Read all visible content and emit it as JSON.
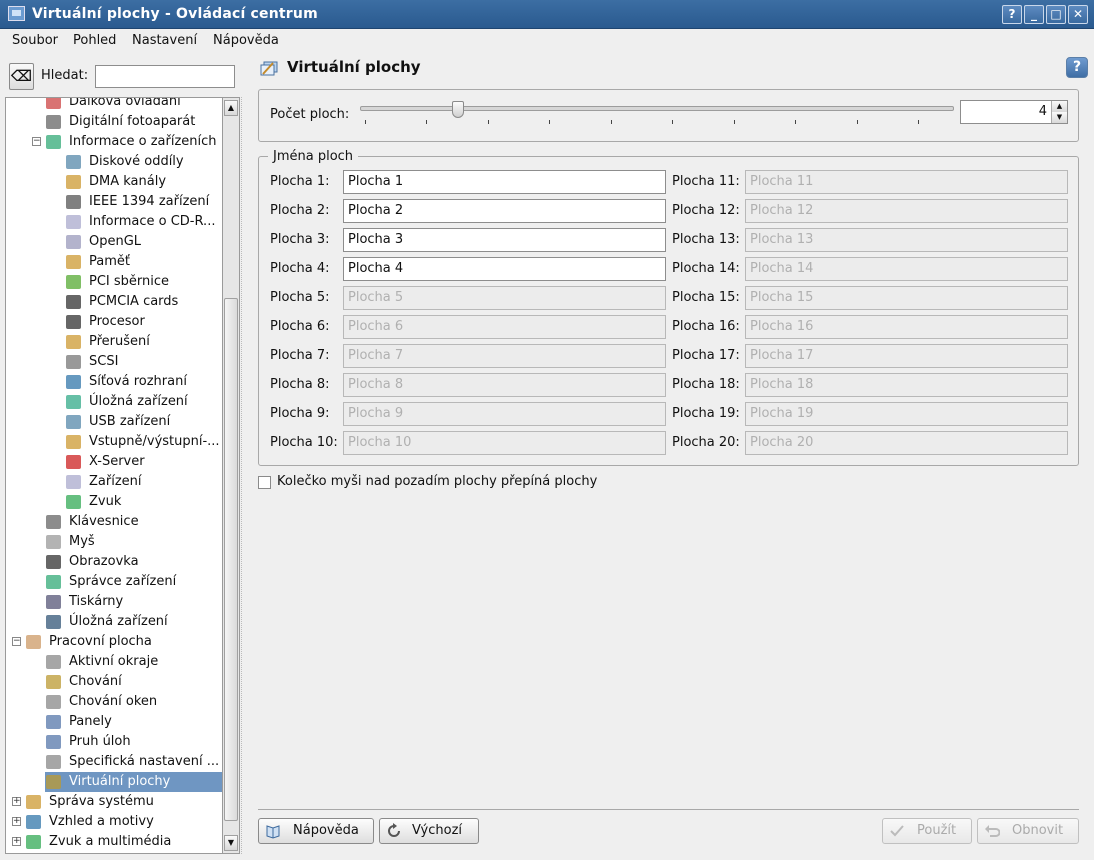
{
  "window": {
    "title": "Virtuální plochy - Ovládací centrum"
  },
  "titlebar_buttons": [
    "?",
    "_",
    "□",
    "✕"
  ],
  "menu": [
    "Soubor",
    "Pohled",
    "Nastavení",
    "Nápověda"
  ],
  "search": {
    "label": "Hledat:",
    "value": ""
  },
  "tree": [
    {
      "label": "Dálková ovládání",
      "icon": "remote-icon",
      "level": 2
    },
    {
      "label": "Digitální fotoaparát",
      "icon": "camera-icon",
      "level": 2
    },
    {
      "label": "Informace o zařízeních",
      "icon": "info-device-icon",
      "level": 2,
      "expander": "−"
    },
    {
      "label": "Diskové oddíly",
      "icon": "disk-partitions-icon",
      "level": 3
    },
    {
      "label": "DMA kanály",
      "icon": "dma-icon",
      "level": 3
    },
    {
      "label": "IEEE 1394 zařízení",
      "icon": "firewire-icon",
      "level": 3
    },
    {
      "label": "Informace o CD-R...",
      "icon": "cdrom-icon",
      "level": 3
    },
    {
      "label": "OpenGL",
      "icon": "opengl-icon",
      "level": 3
    },
    {
      "label": "Paměť",
      "icon": "memory-icon",
      "level": 3
    },
    {
      "label": "PCI sběrnice",
      "icon": "pci-icon",
      "level": 3
    },
    {
      "label": "PCMCIA cards",
      "icon": "pcmcia-icon",
      "level": 3
    },
    {
      "label": "Procesor",
      "icon": "cpu-icon",
      "level": 3
    },
    {
      "label": "Přerušení",
      "icon": "interrupt-icon",
      "level": 3
    },
    {
      "label": "SCSI",
      "icon": "scsi-icon",
      "level": 3
    },
    {
      "label": "Síťová rozhraní",
      "icon": "network-icon",
      "level": 3
    },
    {
      "label": "Úložná zařízení",
      "icon": "storage-icon",
      "level": 3
    },
    {
      "label": "USB zařízení",
      "icon": "usb-icon",
      "level": 3
    },
    {
      "label": "Vstupně/výstupní-...",
      "icon": "io-port-icon",
      "level": 3
    },
    {
      "label": "X-Server",
      "icon": "x-server-icon",
      "level": 3
    },
    {
      "label": "Zařízení",
      "icon": "devices-icon",
      "level": 3
    },
    {
      "label": "Zvuk",
      "icon": "sound-icon",
      "level": 3
    },
    {
      "label": "Klávesnice",
      "icon": "keyboard-icon",
      "level": 2
    },
    {
      "label": "Myš",
      "icon": "mouse-icon",
      "level": 2
    },
    {
      "label": "Obrazovka",
      "icon": "display-icon",
      "level": 2
    },
    {
      "label": "Správce zařízení",
      "icon": "device-manager-icon",
      "level": 2
    },
    {
      "label": "Tiskárny",
      "icon": "printer-icon",
      "level": 2
    },
    {
      "label": "Úložná zařízení",
      "icon": "storage-media-icon",
      "level": 2
    },
    {
      "label": "Pracovní plocha",
      "icon": "desktop-icon",
      "level": 1,
      "expander": "−"
    },
    {
      "label": "Aktivní okraje",
      "icon": "active-borders-icon",
      "level": 2
    },
    {
      "label": "Chování",
      "icon": "behavior-icon",
      "level": 2
    },
    {
      "label": "Chování oken",
      "icon": "window-behavior-icon",
      "level": 2
    },
    {
      "label": "Panely",
      "icon": "panels-icon",
      "level": 2
    },
    {
      "label": "Pruh úloh",
      "icon": "taskbar-icon",
      "level": 2
    },
    {
      "label": "Specifická nastavení ...",
      "icon": "window-specific-icon",
      "level": 2
    },
    {
      "label": "Virtuální plochy",
      "icon": "virtual-desktops-icon",
      "level": 2,
      "selected": true
    },
    {
      "label": "Správa systému",
      "icon": "system-admin-icon",
      "level": 1,
      "expander": "+"
    },
    {
      "label": "Vzhled a motivy",
      "icon": "appearance-icon",
      "level": 1,
      "expander": "+"
    },
    {
      "label": "Zvuk a multimédia",
      "icon": "multimedia-icon",
      "level": 1,
      "expander": "+"
    }
  ],
  "page": {
    "title": "Virtuální plochy"
  },
  "desktops": {
    "count_label": "Počet ploch:",
    "count": 4,
    "slider": {
      "min": 1,
      "max": 20
    },
    "names_group": "Jména ploch",
    "items": [
      {
        "label": "Plocha 1:",
        "value": "Plocha 1",
        "enabled": true
      },
      {
        "label": "Plocha 2:",
        "value": "Plocha 2",
        "enabled": true
      },
      {
        "label": "Plocha 3:",
        "value": "Plocha 3",
        "enabled": true
      },
      {
        "label": "Plocha 4:",
        "value": "Plocha 4",
        "enabled": true
      },
      {
        "label": "Plocha 5:",
        "value": "Plocha 5",
        "enabled": false
      },
      {
        "label": "Plocha 6:",
        "value": "Plocha 6",
        "enabled": false
      },
      {
        "label": "Plocha 7:",
        "value": "Plocha 7",
        "enabled": false
      },
      {
        "label": "Plocha 8:",
        "value": "Plocha 8",
        "enabled": false
      },
      {
        "label": "Plocha 9:",
        "value": "Plocha 9",
        "enabled": false
      },
      {
        "label": "Plocha 10:",
        "value": "Plocha 10",
        "enabled": false
      },
      {
        "label": "Plocha 11:",
        "value": "Plocha 11",
        "enabled": false
      },
      {
        "label": "Plocha 12:",
        "value": "Plocha 12",
        "enabled": false
      },
      {
        "label": "Plocha 13:",
        "value": "Plocha 13",
        "enabled": false
      },
      {
        "label": "Plocha 14:",
        "value": "Plocha 14",
        "enabled": false
      },
      {
        "label": "Plocha 15:",
        "value": "Plocha 15",
        "enabled": false
      },
      {
        "label": "Plocha 16:",
        "value": "Plocha 16",
        "enabled": false
      },
      {
        "label": "Plocha 17:",
        "value": "Plocha 17",
        "enabled": false
      },
      {
        "label": "Plocha 18:",
        "value": "Plocha 18",
        "enabled": false
      },
      {
        "label": "Plocha 19:",
        "value": "Plocha 19",
        "enabled": false
      },
      {
        "label": "Plocha 20:",
        "value": "Plocha 20",
        "enabled": false
      }
    ],
    "wheel_switch_label": "Kolečko myši nad pozadím plochy přepíná plochy",
    "wheel_switch_checked": false
  },
  "buttons": {
    "help": "Nápověda",
    "defaults": "Výchozí",
    "apply": "Použít",
    "reset": "Obnovit"
  },
  "colors": {
    "titlebar": "#2f5f93",
    "selection": "#6f96c2",
    "background": "#efefef"
  }
}
